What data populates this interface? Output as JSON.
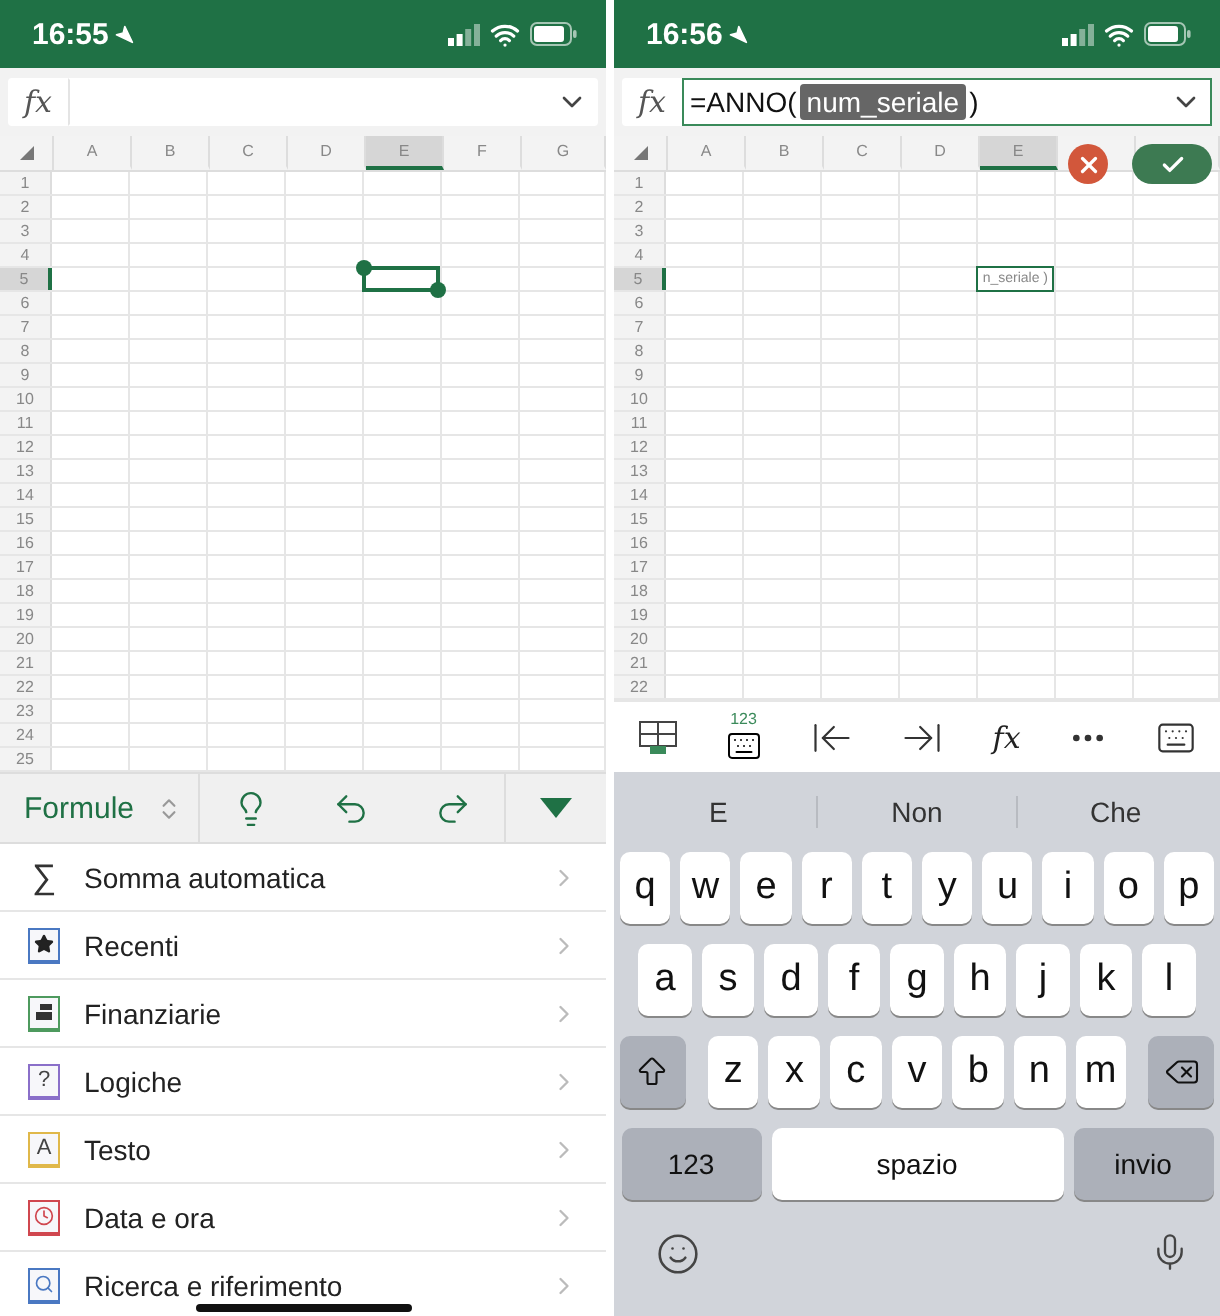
{
  "panes": [
    {
      "status_bar": {
        "time": "16:55"
      },
      "formula_bar": {
        "fx_label": "fx",
        "editing": false
      },
      "columns": [
        {
          "label": "A",
          "selected": false
        },
        {
          "label": "B",
          "selected": false
        },
        {
          "label": "C",
          "selected": false
        },
        {
          "label": "D",
          "selected": false
        },
        {
          "label": "E",
          "selected": true
        },
        {
          "label": "F",
          "selected": false
        },
        {
          "label": "G",
          "selected": false
        }
      ],
      "rows": [
        {
          "label": "1",
          "selected": false
        },
        {
          "label": "2",
          "selected": false
        },
        {
          "label": "3",
          "selected": false
        },
        {
          "label": "4",
          "selected": false
        },
        {
          "label": "5",
          "selected": true
        },
        {
          "label": "6",
          "selected": false
        },
        {
          "label": "7",
          "selected": false
        },
        {
          "label": "8",
          "selected": false
        },
        {
          "label": "9",
          "selected": false
        },
        {
          "label": "10",
          "selected": false
        },
        {
          "label": "11",
          "selected": false
        },
        {
          "label": "12",
          "selected": false
        },
        {
          "label": "13",
          "selected": false
        },
        {
          "label": "14",
          "selected": false
        },
        {
          "label": "15",
          "selected": false
        },
        {
          "label": "16",
          "selected": false
        },
        {
          "label": "17",
          "selected": false
        },
        {
          "label": "18",
          "selected": false
        },
        {
          "label": "19",
          "selected": false
        },
        {
          "label": "20",
          "selected": false
        },
        {
          "label": "21",
          "selected": false
        },
        {
          "label": "22",
          "selected": false
        },
        {
          "label": "23",
          "selected": false
        },
        {
          "label": "24",
          "selected": false
        },
        {
          "label": "25",
          "selected": false
        }
      ],
      "active_cell": {
        "selection_handles": true
      },
      "bottom": {
        "kind": "ribbon",
        "tab": "Formule",
        "items": [
          {
            "kind": "glyph",
            "glyph": "∑",
            "label": "Somma automatica"
          },
          {
            "kind": "star",
            "color": "#4a78c2",
            "label": "Recenti"
          },
          {
            "kind": "finance",
            "color": "#4e9a5e",
            "label": "Finanziarie"
          },
          {
            "kind": "glyph",
            "glyph": "?",
            "color": "#8a6fc9",
            "label": "Logiche"
          },
          {
            "kind": "glyph",
            "glyph": "A",
            "color": "#e0b84a",
            "label": "Testo"
          },
          {
            "kind": "clock",
            "color": "#d0474f",
            "label": "Data e ora"
          },
          {
            "kind": "search",
            "color": "#4a78c2",
            "label": "Ricerca e riferimento"
          }
        ]
      }
    },
    {
      "status_bar": {
        "time": "16:56"
      },
      "formula_bar": {
        "fx_label": "fx",
        "editing": true,
        "formula": {
          "prefix": "=ANNO(",
          "argument": "num_seriale",
          "suffix": ")"
        }
      },
      "columns": [
        {
          "label": "A",
          "selected": false
        },
        {
          "label": "B",
          "selected": false
        },
        {
          "label": "C",
          "selected": false
        },
        {
          "label": "D",
          "selected": false
        },
        {
          "label": "E",
          "selected": true
        }
      ],
      "rows": [
        {
          "label": "1",
          "selected": false
        },
        {
          "label": "2",
          "selected": false
        },
        {
          "label": "3",
          "selected": false
        },
        {
          "label": "4",
          "selected": false
        },
        {
          "label": "5",
          "selected": true
        },
        {
          "label": "6",
          "selected": false
        },
        {
          "label": "7",
          "selected": false
        },
        {
          "label": "8",
          "selected": false
        },
        {
          "label": "9",
          "selected": false
        },
        {
          "label": "10",
          "selected": false
        },
        {
          "label": "11",
          "selected": false
        },
        {
          "label": "12",
          "selected": false
        },
        {
          "label": "13",
          "selected": false
        },
        {
          "label": "14",
          "selected": false
        },
        {
          "label": "15",
          "selected": false
        },
        {
          "label": "16",
          "selected": false
        },
        {
          "label": "17",
          "selected": false
        },
        {
          "label": "18",
          "selected": false
        },
        {
          "label": "19",
          "selected": false
        },
        {
          "label": "20",
          "selected": false
        },
        {
          "label": "21",
          "selected": false
        },
        {
          "label": "22",
          "selected": false
        }
      ],
      "active_cell": {
        "selection_handles": false,
        "cell_text": "n_seriale )"
      },
      "bottom": {
        "kind": "keyboard",
        "numbers_key": "123",
        "function_key": "fx",
        "suggestions": [
          "E",
          "Non",
          "Che"
        ],
        "key_rows": [
          [
            "q",
            "w",
            "e",
            "r",
            "t",
            "y",
            "u",
            "i",
            "o",
            "p"
          ],
          [
            "a",
            "s",
            "d",
            "f",
            "g",
            "h",
            "j",
            "k",
            "l"
          ],
          [
            "z",
            "x",
            "c",
            "v",
            "b",
            "n",
            "m"
          ]
        ],
        "mode_key": "123",
        "space_key": "spazio",
        "return_key": "invio"
      }
    }
  ]
}
